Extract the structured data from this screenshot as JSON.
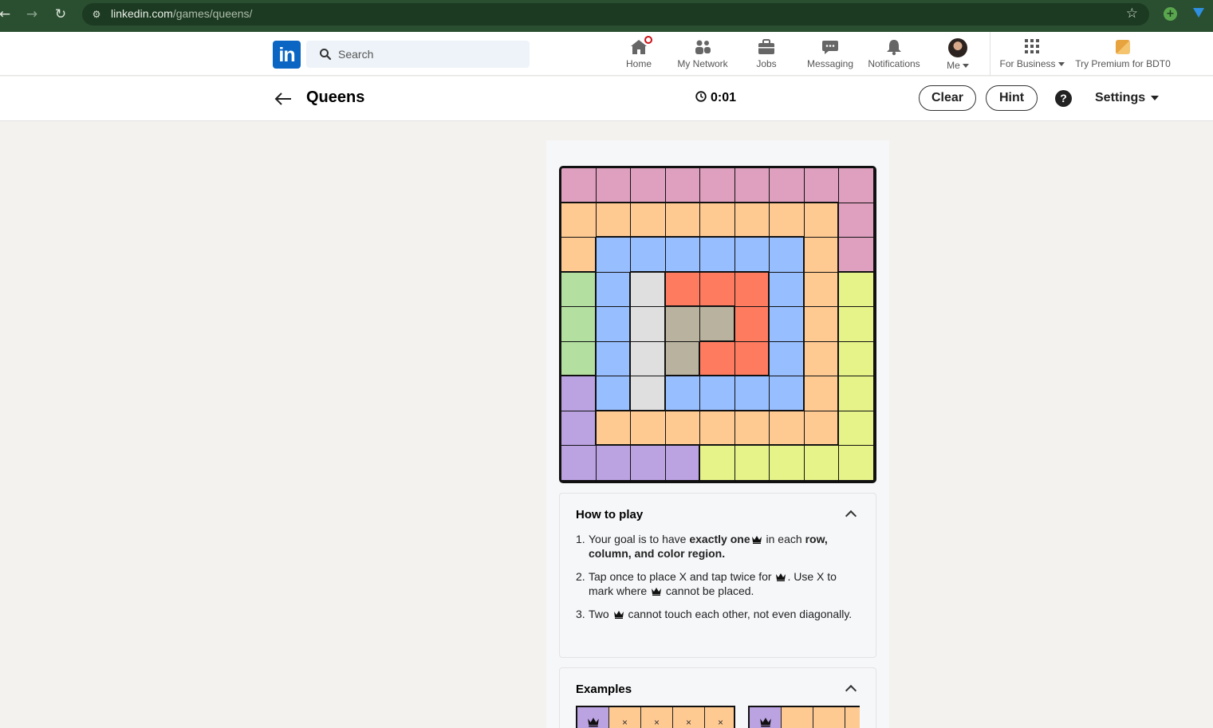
{
  "browser": {
    "url_host": "linkedin.com",
    "url_path": "/games/queens/"
  },
  "header": {
    "logo": "in",
    "search_placeholder": "Search",
    "nav": [
      {
        "label": "Home",
        "icon": "home-icon"
      },
      {
        "label": "My Network",
        "icon": "network-icon"
      },
      {
        "label": "Jobs",
        "icon": "briefcase-icon"
      },
      {
        "label": "Messaging",
        "icon": "messaging-icon"
      },
      {
        "label": "Notifications",
        "icon": "bell-icon"
      },
      {
        "label": "Me",
        "icon": "avatar"
      },
      {
        "label": "For Business",
        "icon": "grid-icon"
      },
      {
        "label": "Try Premium for BDT0",
        "icon": "premium-icon"
      }
    ]
  },
  "game": {
    "title": "Queens",
    "timer": "0:01",
    "clear_label": "Clear",
    "hint_label": "Hint",
    "help_glyph": "?",
    "settings_label": "Settings",
    "colors": {
      "P": "#dfa0c0",
      "O": "#ffc992",
      "B": "#97beff",
      "G": "#b3dfa0",
      "L": "#dfdfdf",
      "R": "#ff7b60",
      "T": "#b9b29e",
      "V": "#bba3e2",
      "Y": "#e6f388"
    },
    "board": [
      "PPPPPPPPP",
      "OOOOOOOOP",
      "OBBBBBBOP",
      "GBLRRRBOY",
      "GBLTTRBOY",
      "GBLTRRBOY",
      "VBLBBBBOY",
      "VOOOOOOOY",
      "VVVVYYYYY"
    ]
  },
  "how_to_play": {
    "title": "How to play",
    "rules": [
      {
        "n": "1.",
        "parts": [
          "Your goal is to have ",
          "exactly one",
          "crown",
          " in each ",
          "row, column, and color region."
        ]
      },
      {
        "n": "2.",
        "parts": [
          "Tap once to place X and tap twice for ",
          "crown",
          ". Use X to mark where ",
          "crown",
          " cannot be placed."
        ]
      },
      {
        "n": "3.",
        "parts": [
          "Two ",
          "crown",
          " cannot touch each other, not even diagonally."
        ]
      }
    ]
  },
  "examples": {
    "title": "Examples",
    "row1": [
      "crown",
      "×",
      "×",
      "×",
      "×"
    ],
    "row2": [
      "crown",
      "",
      "",
      ""
    ],
    "x_mark": "×"
  }
}
